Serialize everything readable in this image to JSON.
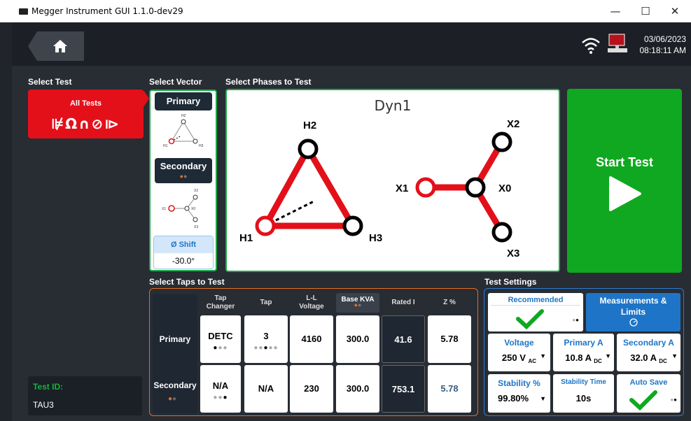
{
  "window": {
    "title": "Megger Instrument GUI 1.1.0-dev29",
    "minimize": "—",
    "maximize": "☐",
    "close": "✕"
  },
  "status": {
    "date": "03/06/2023",
    "time": "08:18:11 AM"
  },
  "sections": {
    "select_test": "Select Test",
    "select_vector": "Select Vector",
    "select_phases": "Select Phases to Test",
    "select_taps": "Select Taps to Test",
    "test_settings": "Test Settings"
  },
  "all_tests": {
    "label": "All Tests",
    "icons": "⊯Ω∩⊘⧐"
  },
  "vector": {
    "primary": "Primary",
    "secondary": "Secondary",
    "phase_shift_label": "Ø Shift",
    "phase_shift_value": "-30.0°",
    "primary_diagram": {
      "h1": "H1",
      "h2": "H2",
      "h3": "H3"
    },
    "secondary_diagram": {
      "x0": "X0",
      "x1": "X1",
      "x2": "X2",
      "x3": "X3"
    }
  },
  "phases": {
    "vector_group": "Dyn1",
    "h1": "H1",
    "h2": "H2",
    "h3": "H3",
    "x0": "X0",
    "x1": "X1",
    "x2": "X2",
    "x3": "X3"
  },
  "start_test": {
    "label": "Start Test"
  },
  "taps": {
    "headers": {
      "tap_changer": "Tap\nChanger",
      "tap": "Tap",
      "ll_voltage": "L-L\nVoltage",
      "base_kva": "Base KVA",
      "rated_i": "Rated I",
      "z_pct": "Z %"
    },
    "primary": {
      "label": "Primary",
      "tap_changer": "DETC",
      "tap": "3",
      "ll_voltage": "4160",
      "base_kva": "300.0",
      "rated_i": "41.6",
      "z_pct": "5.78"
    },
    "secondary": {
      "label": "Secondary",
      "tap_changer": "N/A",
      "tap": "N/A",
      "ll_voltage": "230",
      "base_kva": "300.0",
      "rated_i": "753.1",
      "z_pct": "5.78"
    }
  },
  "settings": {
    "recommended": "Recommended",
    "measurements": "Measurements & Limits",
    "voltage": {
      "label": "Voltage",
      "value": "250 V",
      "unit": "AC"
    },
    "primary_a": {
      "label": "Primary A",
      "value": "10.8 A",
      "unit": "DC"
    },
    "secondary_a": {
      "label": "Secondary A",
      "value": "32.0 A",
      "unit": "DC"
    },
    "stability_pct": {
      "label": "Stability %",
      "value": "99.80%"
    },
    "stability_time": {
      "label": "Stability Time",
      "value": "10s"
    },
    "auto_save": {
      "label": "Auto Save"
    }
  },
  "test_id": {
    "label": "Test ID:",
    "value": "TAU3"
  },
  "colors": {
    "accent_red": "#e3101a",
    "accent_green": "#10a820",
    "accent_blue": "#1e75c7",
    "panel_orange": "#e96b1f"
  }
}
